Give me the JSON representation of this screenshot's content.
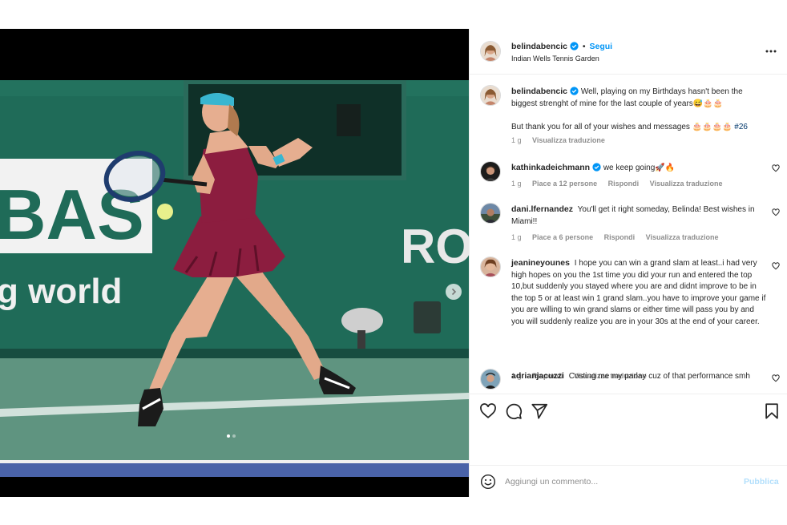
{
  "post": {
    "username": "belindabencic",
    "follow_label": "Segui",
    "separator": "•",
    "location": "Indian Wells Tennis Garden"
  },
  "photo": {
    "banner_left_text": "BAS",
    "banner_bottom_text": "g world",
    "banner_right_text": "RO"
  },
  "caption": {
    "username": "belindabencic",
    "text": "Well, playing on my Birthdays hasn't been the biggest strenght of mine for the last couple of years😅🎂🎂",
    "text2": "But thank you for all of your wishes and messages 🎂🎂🎂🎂",
    "hashtag": "#26",
    "time": "1 g",
    "translate": "Visualizza traduzione"
  },
  "comments": [
    {
      "username": "kathinkadeichmann",
      "text": "we keep going🚀🔥",
      "time": "1 g",
      "likes": "Piace a 12 persone",
      "reply": "Rispondi",
      "translate": "Visualizza traduzione"
    },
    {
      "username": "dani.lfernandez",
      "text": "You'll get it right someday, Belinda! Best wishes in Miami!!",
      "time": "1 g",
      "likes": "Piace a 6 persone",
      "reply": "Rispondi",
      "translate": "Visualizza traduzione"
    },
    {
      "username": "jeanineyounes",
      "text": "I hope you can win a grand slam at least..i had very high hopes on you the 1st time you did your run and entered the top 10,but suddenly you stayed where you are and didnt improve to be in the top 5 or at least win 1 grand slam..you have to improve your game if you are willing to win grand slams or either time will pass you by and you will suddenly realize you are in your 30s at the end of your career.",
      "time": "1 g",
      "reply": "Rispondi",
      "translate": "Visualizza traduzione"
    },
    {
      "username": "adrianjacuzzi",
      "text": "Costing me my parlay cuz of that performance smh"
    }
  ],
  "add_comment": {
    "placeholder": "Aggiungi un commento...",
    "publish_label": "Pubblica"
  },
  "colors": {
    "accent": "#0095f6",
    "hashtag": "#00376b",
    "muted": "#8e8e8e",
    "court_wall": "#1f6b58",
    "court_floor": "#5f9480",
    "dress": "#8c1d3f"
  },
  "icons": {
    "more": "more-horizontal-icon",
    "next": "chevron-right-icon",
    "like": "heart-icon",
    "comment": "comment-icon",
    "share": "send-icon",
    "save": "bookmark-icon",
    "emoji": "emoji-icon",
    "verified": "verified-badge-icon"
  }
}
